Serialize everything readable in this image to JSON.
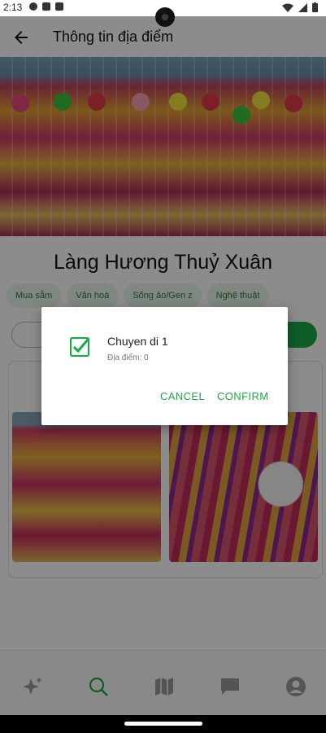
{
  "status_bar": {
    "time": "2:13"
  },
  "header": {
    "title": "Thông tin địa điểm"
  },
  "place": {
    "name": "Làng Hương Thuỷ Xuân"
  },
  "chips": [
    "Mua sắm",
    "Văn hoá",
    "Sống ảo/Gen z",
    "Nghệ thuật"
  ],
  "dialog": {
    "item_name": "Chuyen di 1",
    "item_detail": "Địa điểm: 0",
    "item_checked": true,
    "cancel_label": "CANCEL",
    "confirm_label": "CONFIRM"
  },
  "bottom_nav": [
    "sparkle-icon",
    "search-icon",
    "map-icon",
    "chat-icon",
    "profile-icon"
  ],
  "colors": {
    "accent": "#1aaa47",
    "chip_bg": "#e8f6ea",
    "scrim": "rgba(0,0,0,0.45)"
  }
}
